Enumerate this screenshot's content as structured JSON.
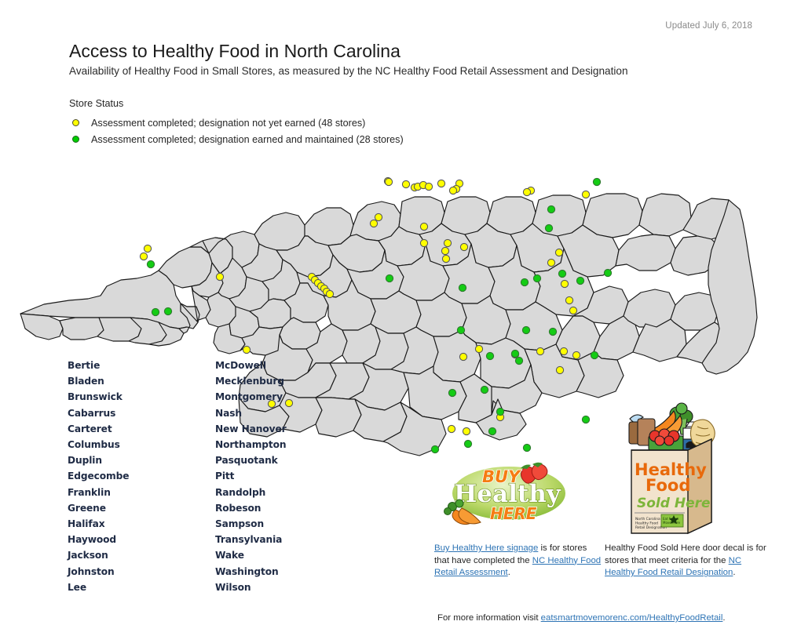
{
  "header": {
    "updated": "Updated July 6, 2018",
    "title": "Access to Healthy Food in North Carolina",
    "subtitle": "Availability of Healthy Food in Small Stores, as measured by the NC Healthy Food Retail Assessment and Designation"
  },
  "legend": {
    "title": "Store Status",
    "items": [
      {
        "color": "#FFFF00",
        "marker": "yellow-circle-marker",
        "label": "Assessment completed; designation not yet earned (48 stores)"
      },
      {
        "color": "#00CC00",
        "marker": "green-circle-marker",
        "label": "Assessment completed; designation earned and maintained (28 stores)"
      }
    ]
  },
  "counties": {
    "column1": [
      "Bertie",
      "Bladen",
      "Brunswick",
      "Cabarrus",
      "Carteret",
      "Columbus",
      "Duplin",
      "Edgecombe",
      "Franklin",
      "Greene",
      "Halifax",
      "Haywood",
      "Jackson",
      "Johnston",
      "Lee"
    ],
    "column2": [
      "McDowell",
      "Mecklenburg",
      "Montgomery",
      "Nash",
      "New Hanover",
      "Northampton",
      "Pasquotank",
      "Pitt",
      "Randolph",
      "Robeson",
      "Sampson",
      "Transylvania",
      "Wake",
      "Washington",
      "Wilson"
    ]
  },
  "logos": {
    "buy_healthy_here": {
      "line1": "BUY",
      "line2": "Healthy",
      "line3": "HERE"
    },
    "healthy_food_sold_here": {
      "line1": "Healthy",
      "line2": "Food",
      "line3": "Sold Here",
      "footer": "North Carolina\nHealthy Food\nRetail Designation",
      "badge": "Eat Smart Move More"
    }
  },
  "footer": {
    "left": {
      "link1": "Buy Healthy Here signage",
      "text1": " is for stores that have completed the ",
      "link2": "NC Healthy Food Retail Assessment",
      "text2": "."
    },
    "right": {
      "text1": "Healthy Food Sold Here door decal is for stores that meet criteria for the ",
      "link1": "NC Healthy Food Retail Designation",
      "text2": "."
    },
    "more": {
      "text1": "For more information visit ",
      "link1": "eatsmartmovemorenc.com/HealthyFoodRetail",
      "text2": "."
    }
  },
  "map": {
    "name": "north-carolina-county-map",
    "county_fill": "#D9D9D9",
    "county_stroke": "#1a1a1a",
    "points_yellow": [
      [
        264,
        148
      ],
      [
        172,
        112
      ],
      [
        167,
        122
      ],
      [
        696,
        117
      ],
      [
        703,
        157
      ],
      [
        709,
        178
      ],
      [
        714,
        191
      ],
      [
        702,
        243
      ],
      [
        697,
        267
      ],
      [
        501,
        30
      ],
      [
        512,
        34
      ],
      [
        516,
        33
      ],
      [
        523,
        31
      ],
      [
        530,
        33
      ],
      [
        546,
        29
      ],
      [
        569,
        29
      ],
      [
        730,
        43
      ],
      [
        660,
        38
      ],
      [
        655,
        40
      ],
      [
        565,
        36
      ],
      [
        561,
        38
      ],
      [
        478,
        26
      ],
      [
        479,
        27
      ],
      [
        524,
        84
      ],
      [
        524,
        105
      ],
      [
        552,
        125
      ],
      [
        466,
        72
      ],
      [
        460,
        80
      ],
      [
        551,
        115
      ],
      [
        575,
        110
      ],
      [
        381,
        148
      ],
      [
        385,
        152
      ],
      [
        389,
        156
      ],
      [
        393,
        160
      ],
      [
        397,
        163
      ],
      [
        400,
        167
      ],
      [
        404,
        170
      ],
      [
        686,
        130
      ],
      [
        640,
        247
      ],
      [
        672,
        243
      ],
      [
        594,
        240
      ],
      [
        574,
        250
      ],
      [
        298,
        241
      ],
      [
        330,
        310
      ],
      [
        352,
        309
      ],
      [
        554,
        105
      ],
      [
        621,
        327
      ],
      [
        578,
        345
      ],
      [
        559,
        342
      ],
      [
        718,
        248
      ]
    ],
    "points_green": [
      [
        744,
        27
      ],
      [
        686,
        62
      ],
      [
        683,
        86
      ],
      [
        176,
        132
      ],
      [
        182,
        193
      ],
      [
        198,
        192
      ],
      [
        723,
        153
      ],
      [
        758,
        143
      ],
      [
        652,
        155
      ],
      [
        573,
        162
      ],
      [
        654,
        216
      ],
      [
        571,
        216
      ],
      [
        640,
        246
      ],
      [
        480,
        150
      ],
      [
        645,
        255
      ],
      [
        601,
        292
      ],
      [
        621,
        320
      ],
      [
        580,
        361
      ],
      [
        538,
        368
      ],
      [
        741,
        248
      ],
      [
        700,
        144
      ],
      [
        611,
        345
      ],
      [
        668,
        150
      ],
      [
        655,
        366
      ],
      [
        730,
        330
      ],
      [
        688,
        218
      ],
      [
        608,
        249
      ],
      [
        560,
        296
      ]
    ]
  }
}
